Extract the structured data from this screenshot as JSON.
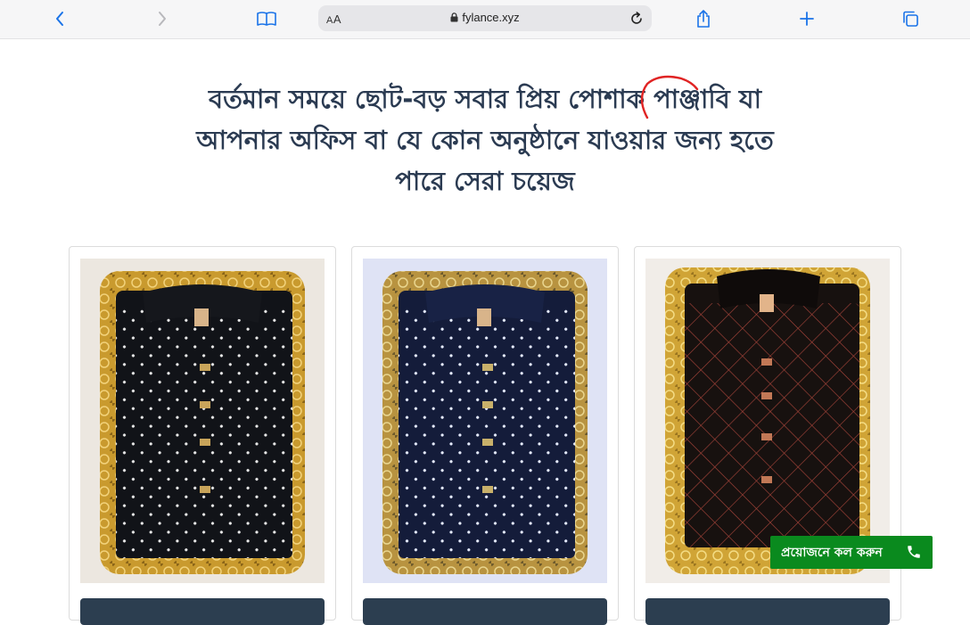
{
  "browser": {
    "aa_label_small": "A",
    "aa_label_big": "A",
    "url": "fylance.xyz",
    "icons": [
      "back-icon",
      "forward-icon",
      "bookmarks-icon",
      "lock-icon",
      "reload-icon",
      "share-icon",
      "new-tab-icon",
      "tabs-icon"
    ]
  },
  "hero": {
    "headline_line1": "বর্তমান সময়ে ছোট-বড় সবার প্রিয় পোশাক পাঞ্জাবি যা",
    "headline_line2": "আপনার অফিস বা যে কোন অনুষ্ঠানে যাওয়ার জন্য হতে",
    "headline_line3": "পারে সেরা চয়েজ"
  },
  "products": [
    {
      "pattern": "white dots on black",
      "fabric_color": "#111318",
      "dot_color": "#e8e8e8"
    },
    {
      "pattern": "white dots on navy",
      "fabric_color": "#141c3a",
      "dot_color": "#e6ecff"
    },
    {
      "pattern": "red check on black",
      "fabric_color": "#17110f",
      "dot_color": "#a8443a"
    }
  ],
  "call_button": {
    "label": "প্রয়োজনে কল করুন",
    "icon": "phone-icon",
    "color": "#0a8a1e"
  },
  "colors": {
    "headline": "#2b3b52",
    "accent_mark": "#e02424",
    "card_button": "#2c3e50"
  }
}
